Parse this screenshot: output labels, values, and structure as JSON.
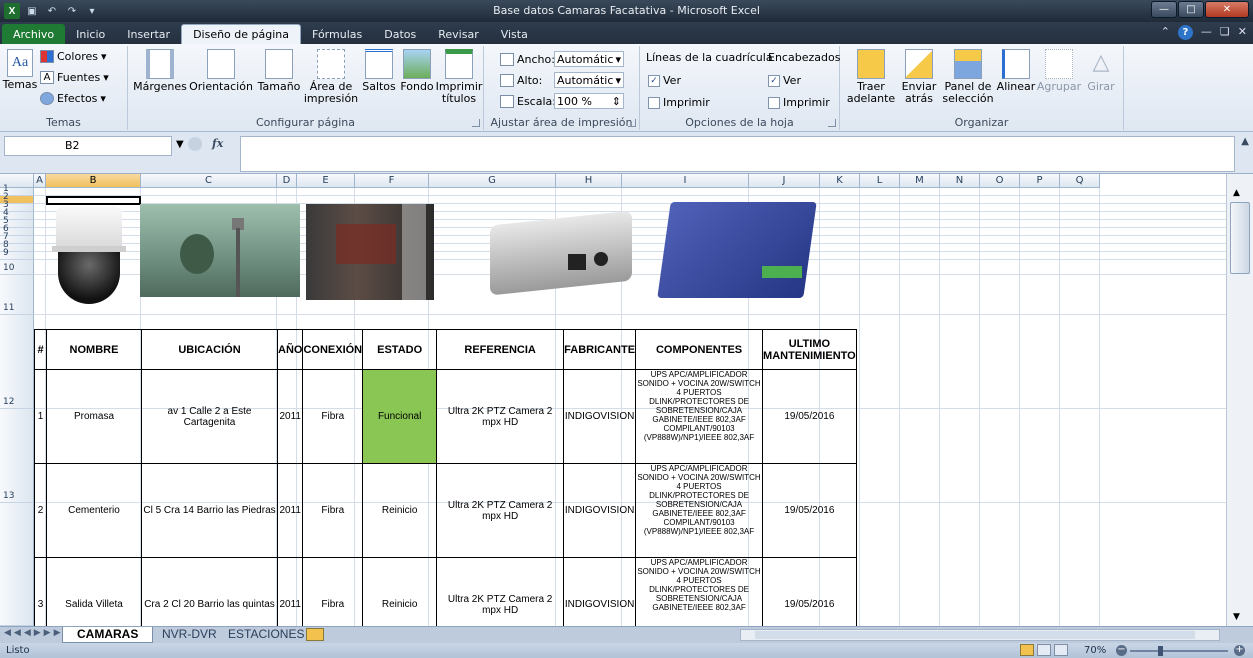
{
  "window": {
    "title": "Base datos Camaras Facatativa - Microsoft Excel",
    "minimize_icon": "minimize-icon",
    "maximize_icon": "maximize-icon",
    "close_icon": "close-icon"
  },
  "ribbon_tabs": [
    {
      "label": "Archivo"
    },
    {
      "label": "Inicio"
    },
    {
      "label": "Insertar"
    },
    {
      "label": "Diseño de página",
      "active": true
    },
    {
      "label": "Fórmulas"
    },
    {
      "label": "Datos"
    },
    {
      "label": "Revisar"
    },
    {
      "label": "Vista"
    }
  ],
  "ribbon": {
    "temas": {
      "label": "Temas",
      "temas_btn": "Temas",
      "colores": "Colores",
      "fuentes": "Fuentes",
      "efectos": "Efectos"
    },
    "configurar": {
      "label": "Configurar página",
      "margenes": "Márgenes",
      "orientacion": "Orientación",
      "tamano": "Tamaño",
      "area_line1": "Área de",
      "area_line2": "impresión",
      "saltos": "Saltos",
      "fondo": "Fondo",
      "imprimir_line1": "Imprimir",
      "imprimir_line2": "títulos"
    },
    "ajustar": {
      "label": "Ajustar área de impresión",
      "ancho": "Ancho:",
      "ancho_val": "Automátic",
      "alto": "Alto:",
      "alto_val": "Automátic",
      "escala": "Escala:",
      "escala_val": "100 %"
    },
    "opciones": {
      "label": "Opciones de la hoja",
      "lineas": "Líneas de la cuadrícula",
      "encabezados": "Encabezados",
      "ver": "Ver",
      "imprimir": "Imprimir"
    },
    "organizar": {
      "label": "Organizar",
      "traer_line1": "Traer",
      "traer_line2": "adelante",
      "enviar_line1": "Enviar",
      "enviar_line2": "atrás",
      "panel_line1": "Panel de",
      "panel_line2": "selección",
      "alinear": "Alinear",
      "agrupar": "Agrupar",
      "girar": "Girar"
    }
  },
  "formula_bar": {
    "name_box": "B2",
    "fx": "fx",
    "formula": ""
  },
  "columns": [
    "A",
    "B",
    "C",
    "D",
    "E",
    "F",
    "G",
    "H",
    "I",
    "J",
    "K",
    "L",
    "M",
    "N",
    "O",
    "P",
    "Q"
  ],
  "rows": [
    "1",
    "2",
    "3",
    "4",
    "5",
    "6",
    "7",
    "8",
    "9",
    "10",
    "11",
    "12",
    "13"
  ],
  "table": {
    "headers": [
      "#",
      "NOMBRE",
      "UBICACIÓN",
      "AÑO",
      "CONEXIÓN",
      "ESTADO",
      "REFERENCIA",
      "FABRICANTE",
      "COMPONENTES",
      "ULTIMO MANTENIMIENTO"
    ],
    "rows": [
      {
        "num": "1",
        "nombre": "Promasa",
        "ubicacion": "av 1 Calle 2 a Este Cartagenita",
        "anio": "2011",
        "conexion": "Fibra",
        "estado": "Funcional",
        "referencia": "Ultra 2K PTZ Camera 2 mpx HD",
        "fabricante": "INDIGOVISION",
        "componentes": "UPS APC/AMPLIFICADOR SONIDO + VOCINA 20W/SWITCH 4 PUERTOS DLINK/PROTECTORES DE SOBRETENSION/CAJA GABINETE/IEEE 802,3AF COMPILANT/90103 (VP888W)/NP1)/IEEE 802,3AF",
        "mantenimiento": "19/05/2016"
      },
      {
        "num": "2",
        "nombre": "Cementerio",
        "ubicacion": "Cl 5 Cra 14 Barrio las Piedras",
        "anio": "2011",
        "conexion": "Fibra",
        "estado": "Reinicio",
        "referencia": "Ultra 2K PTZ Camera 2 mpx HD",
        "fabricante": "INDIGOVISION",
        "componentes": "UPS APC/AMPLIFICADOR SONIDO + VOCINA 20W/SWITCH 4 PUERTOS DLINK/PROTECTORES DE SOBRETENSION/CAJA GABINETE/IEEE 802,3AF COMPILANT/90103 (VP888W)/NP1)/IEEE 802,3AF",
        "mantenimiento": "19/05/2016"
      },
      {
        "num": "3",
        "nombre": "Salida Villeta",
        "ubicacion": "Cra 2 Cl 20 Barrio las quintas",
        "anio": "2011",
        "conexion": "Fibra",
        "estado": "Reinicio",
        "referencia": "Ultra 2K PTZ Camera 2 mpx HD",
        "fabricante": "INDIGOVISION",
        "componentes": "UPS APC/AMPLIFICADOR SONIDO + VOCINA 20W/SWITCH 4 PUERTOS DLINK/PROTECTORES DE SOBRETENSION/CAJA GABINETE/IEEE 802,3AF",
        "mantenimiento": "19/05/2016"
      }
    ]
  },
  "sheets": [
    {
      "label": "CAMARAS",
      "active": true
    },
    {
      "label": "NVR-DVR"
    },
    {
      "label": "ESTACIONES"
    }
  ],
  "status": {
    "ready": "Listo",
    "zoom": "70%"
  },
  "colors": {
    "funcional": "#8ac654",
    "selected_header": "#f1c15f",
    "file_tab": "#1f7a34"
  }
}
